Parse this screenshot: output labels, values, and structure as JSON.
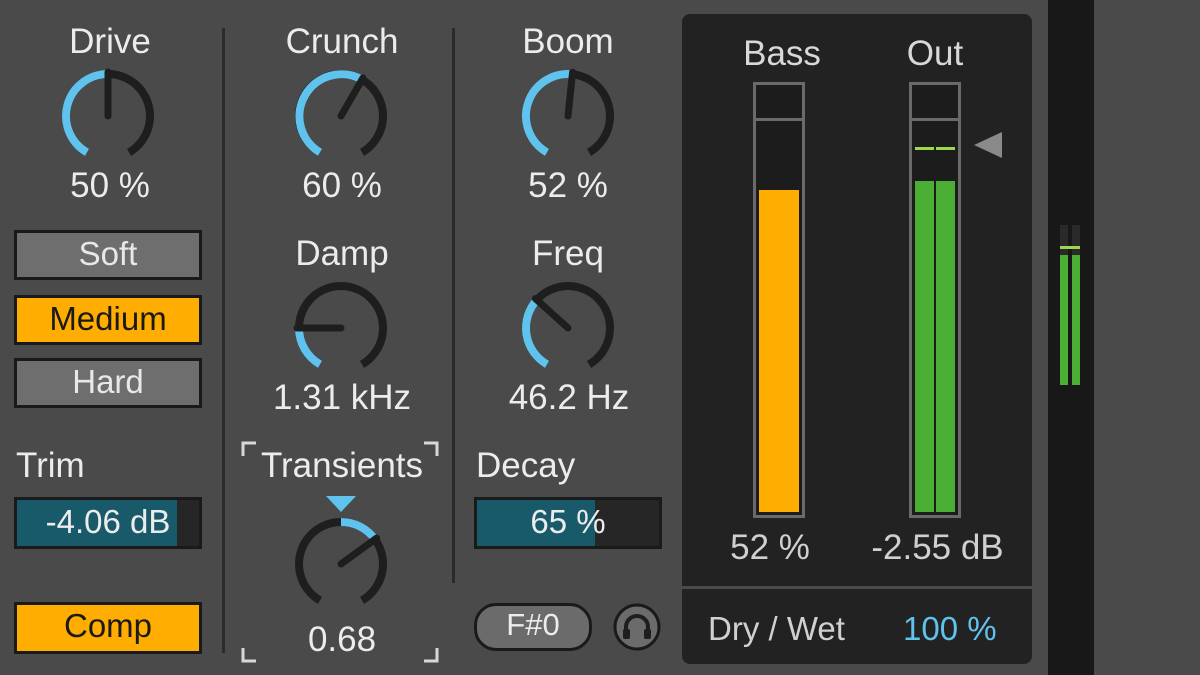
{
  "drive": {
    "label": "Drive",
    "value_text": "50 %",
    "value": 0.5
  },
  "crunch": {
    "label": "Crunch",
    "value_text": "60 %",
    "value": 0.6
  },
  "boom": {
    "label": "Boom",
    "value_text": "52 %",
    "value": 0.52
  },
  "damp": {
    "label": "Damp",
    "value_text": "1.31 kHz",
    "value": 0.2
  },
  "freq": {
    "label": "Freq",
    "value_text": "46.2 Hz",
    "value": 0.34
  },
  "transients": {
    "label": "Transients",
    "value_text": "0.68",
    "value": 0.68
  },
  "modes": {
    "soft": "Soft",
    "medium": "Medium",
    "hard": "Hard",
    "selected": "Medium"
  },
  "trim": {
    "label": "Trim",
    "value_text": "-4.06 dB",
    "fill": 0.88
  },
  "comp": {
    "label": "Comp",
    "active": true
  },
  "decay": {
    "label": "Decay",
    "value_text": "65 %",
    "fill": 0.65
  },
  "note": {
    "label": "F#0"
  },
  "headphone": {
    "icon": "headphones-icon"
  },
  "meters": {
    "bass": {
      "label": "Bass",
      "value_text": "52 %",
      "level": 0.76
    },
    "out": {
      "label": "Out",
      "value_text": "-2.55 dB",
      "level": 0.78
    }
  },
  "drywet": {
    "label": "Dry / Wet",
    "value_text": "100 %"
  },
  "colors": {
    "accent_blue": "#5fc3ee",
    "orange": "#ffad00",
    "green": "#4caf35",
    "teal": "#195a6a",
    "bg": "#4a4a4a"
  }
}
